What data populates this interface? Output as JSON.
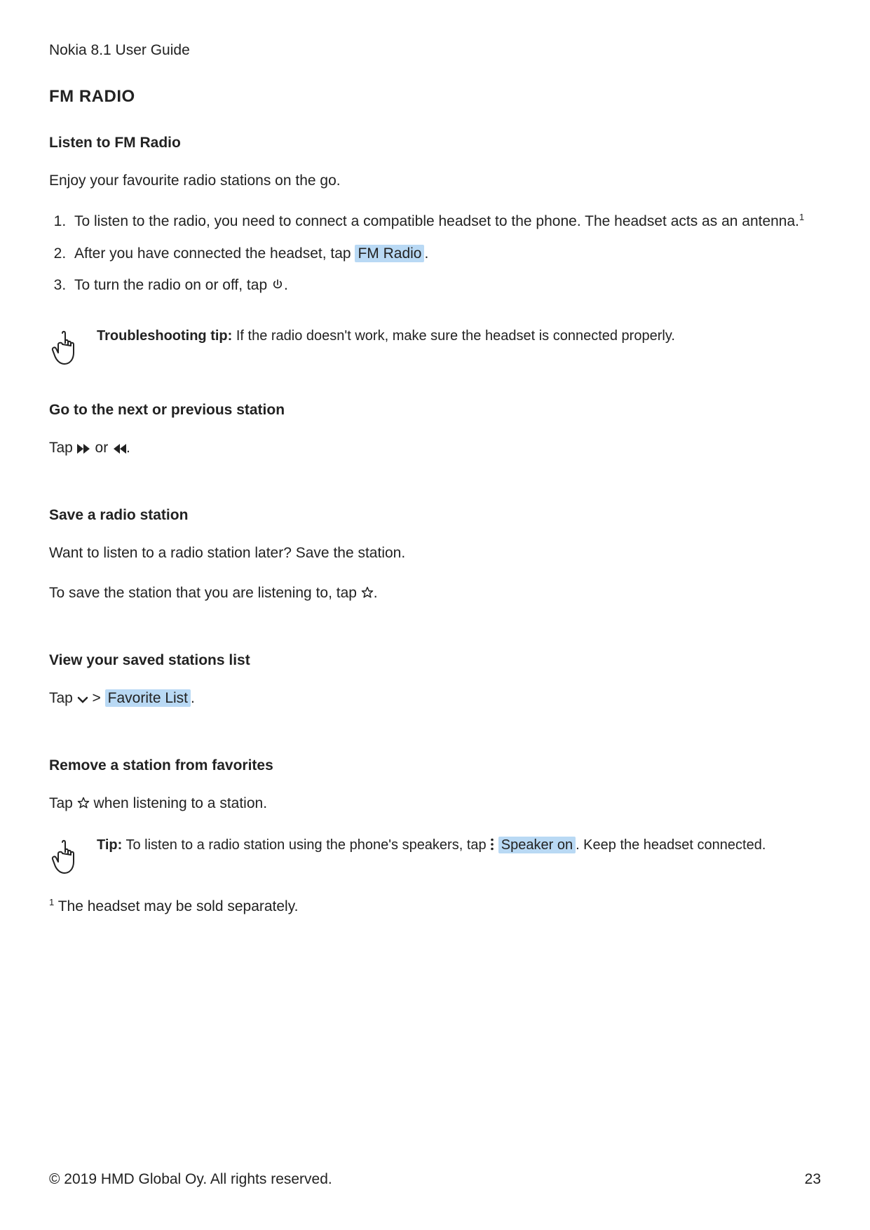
{
  "doc_title": "Nokia 8.1 User Guide",
  "h1": "FM RADIO",
  "sec1": {
    "head": "Listen to FM Radio",
    "intro": "Enjoy your favourite radio stations on the go.",
    "step1": "To listen to the radio, you need to connect a compatible headset to the phone. The headset acts as an antenna.",
    "step1_footref": "1",
    "step2_pre": "After you have connected the headset, tap ",
    "step2_hi": "FM Radio",
    "step2_post": ".",
    "step3_pre": "To turn the radio on or off, tap ",
    "step3_post": "."
  },
  "tip1": {
    "label": "Troubleshooting tip:",
    "text": " If the radio doesn't work, make sure the headset is connected properly."
  },
  "sec2": {
    "head": "Go to the next or previous station",
    "tap_pre": "Tap ",
    "tap_mid": " or ",
    "tap_post": "."
  },
  "sec3": {
    "head": "Save a radio station",
    "intro1": "Want to listen to a radio station later? Save the station.",
    "intro2_pre": "To save the station that you are listening to, tap ",
    "intro2_post": "."
  },
  "sec4": {
    "head": "View your saved stations list",
    "tap_pre": "Tap ",
    "tap_mid": " > ",
    "tap_hi": "Favorite List",
    "tap_post": "."
  },
  "sec5": {
    "head": "Remove a station from favorites",
    "tap_pre": "Tap ",
    "tap_post": " when listening to a station."
  },
  "tip2": {
    "label": "Tip:",
    "text_pre": " To listen to a radio station using the phone's speakers, tap ",
    "hi": "Speaker on",
    "text_post": ". Keep the headset connected."
  },
  "footnote": {
    "ref": "1",
    "text": " The headset may be sold separately."
  },
  "footer": {
    "copyright": "© 2019 HMD Global Oy. All rights reserved.",
    "page": "23"
  }
}
